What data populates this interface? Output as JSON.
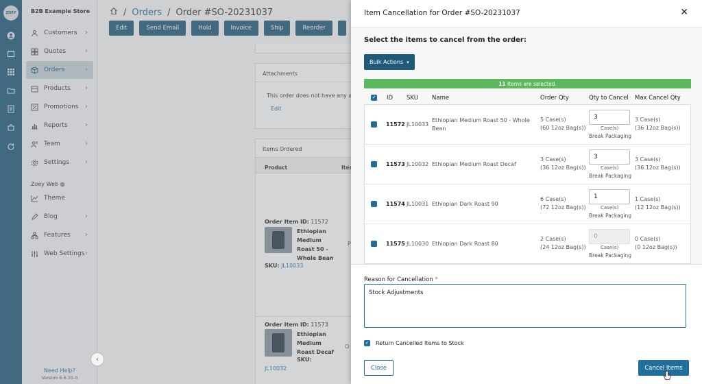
{
  "rail": {
    "logo": "ZOEY"
  },
  "sidebar": {
    "store_name": "B2B Example Store",
    "items": [
      {
        "label": "Customers",
        "icon": "customers-icon"
      },
      {
        "label": "Quotes",
        "icon": "quotes-icon"
      },
      {
        "label": "Orders",
        "icon": "orders-icon"
      },
      {
        "label": "Products",
        "icon": "products-icon"
      },
      {
        "label": "Promotions",
        "icon": "promotions-icon"
      },
      {
        "label": "Reports",
        "icon": "reports-icon"
      },
      {
        "label": "Team",
        "icon": "team-icon"
      },
      {
        "label": "Settings",
        "icon": "settings-icon"
      }
    ],
    "zoey_web_label": "Zoey Web",
    "web_items": [
      {
        "label": "Theme"
      },
      {
        "label": "Blog"
      },
      {
        "label": "Features"
      },
      {
        "label": "Web Settings"
      }
    ],
    "need_help": "Need Help?",
    "version": "Version 6.6.35-0"
  },
  "header": {
    "crumb_orders": "Orders",
    "crumb_order": "Order #SO-20231037",
    "separator": "/",
    "buttons": [
      "Edit",
      "Send Email",
      "Hold",
      "Invoice",
      "Ship",
      "Reorder"
    ]
  },
  "background": {
    "attachments_title": "Attachments",
    "attachments_text": "This order does not have any at",
    "attachments_edit": "Edit",
    "items_title": "Items Ordered",
    "col_product": "Product",
    "col_item": "Item",
    "p1_id_label": "Order Item ID:",
    "p1_id": "11572",
    "p1_name": "Ethiopian Medium Roast 50 - Whole Bean",
    "p1_sku_label": "SKU:",
    "p1_sku": "JL10033",
    "p1_extra": "P",
    "p2_id_label": "Order Item ID:",
    "p2_id": "11573",
    "p2_name": "Ethiopian Medium Roast Decaf",
    "p2_sku_label": "SKU:",
    "p2_sku": "JL10032",
    "p2_extra": "O"
  },
  "modal": {
    "title": "Item Cancellation for Order #SO-20231037",
    "subtitle": "Select the items to cancel from the order:",
    "bulk_actions": "Bulk Actions",
    "selected_count": "11",
    "selected_text": "Items are selected.",
    "columns": {
      "id": "ID",
      "sku": "SKU",
      "name": "Name",
      "order_qty": "Order Qty",
      "qty_to_cancel": "Qty to Cancel",
      "max_cancel": "Max Cancel Qty"
    },
    "rows": [
      {
        "id": "11572",
        "sku": "JL10033",
        "name": "Ethiopian Medium Roast 50 - Whole Bean",
        "order_qty": "5 Case(s)",
        "order_qty_sub": "(60 12oz Bag(s))",
        "qty": "3",
        "qty_unit": "Case(s)",
        "break": "Break Packaging",
        "max": "3 Case(s)",
        "max_sub": "(36 12oz Bag(s))"
      },
      {
        "id": "11573",
        "sku": "JL10032",
        "name": "Ethiopian Medium Roast Decaf",
        "order_qty": "3 Case(s)",
        "order_qty_sub": "(36 12oz Bag(s))",
        "qty": "3",
        "qty_unit": "Case(s)",
        "break": "Break Packaging",
        "max": "3 Case(s)",
        "max_sub": "(36 12oz Bag(s))"
      },
      {
        "id": "11574",
        "sku": "JL10031",
        "name": "Ethiopian Dark Roast 90",
        "order_qty": "6 Case(s)",
        "order_qty_sub": "(72 12oz Bag(s))",
        "qty": "1",
        "qty_unit": "Case(s)",
        "break": "Break Packaging",
        "max": "1 Case(s)",
        "max_sub": "(12 12oz Bag(s))"
      },
      {
        "id": "11575",
        "sku": "JL10030",
        "name": "Ethiopian Dark Roast 80",
        "order_qty": "2 Case(s)",
        "order_qty_sub": "(24 12oz Bag(s))",
        "qty": "",
        "qty_placeholder": "0",
        "qty_unit": "Case(s)",
        "break": "Break Packaging",
        "max": "0 Case(s)",
        "max_sub": "(0 12oz Bag(s))"
      }
    ],
    "reason_label": "Reason for Cancellation",
    "reason_required": "*",
    "reason_value": "Stock Adjustments",
    "return_label": "Return Cancelled Items to Stock",
    "close_label": "Close",
    "cancel_label": "Cancel Items"
  },
  "colors": {
    "primary": "#1f5a78",
    "link": "#1f6e9c",
    "success": "#5cb85c"
  }
}
